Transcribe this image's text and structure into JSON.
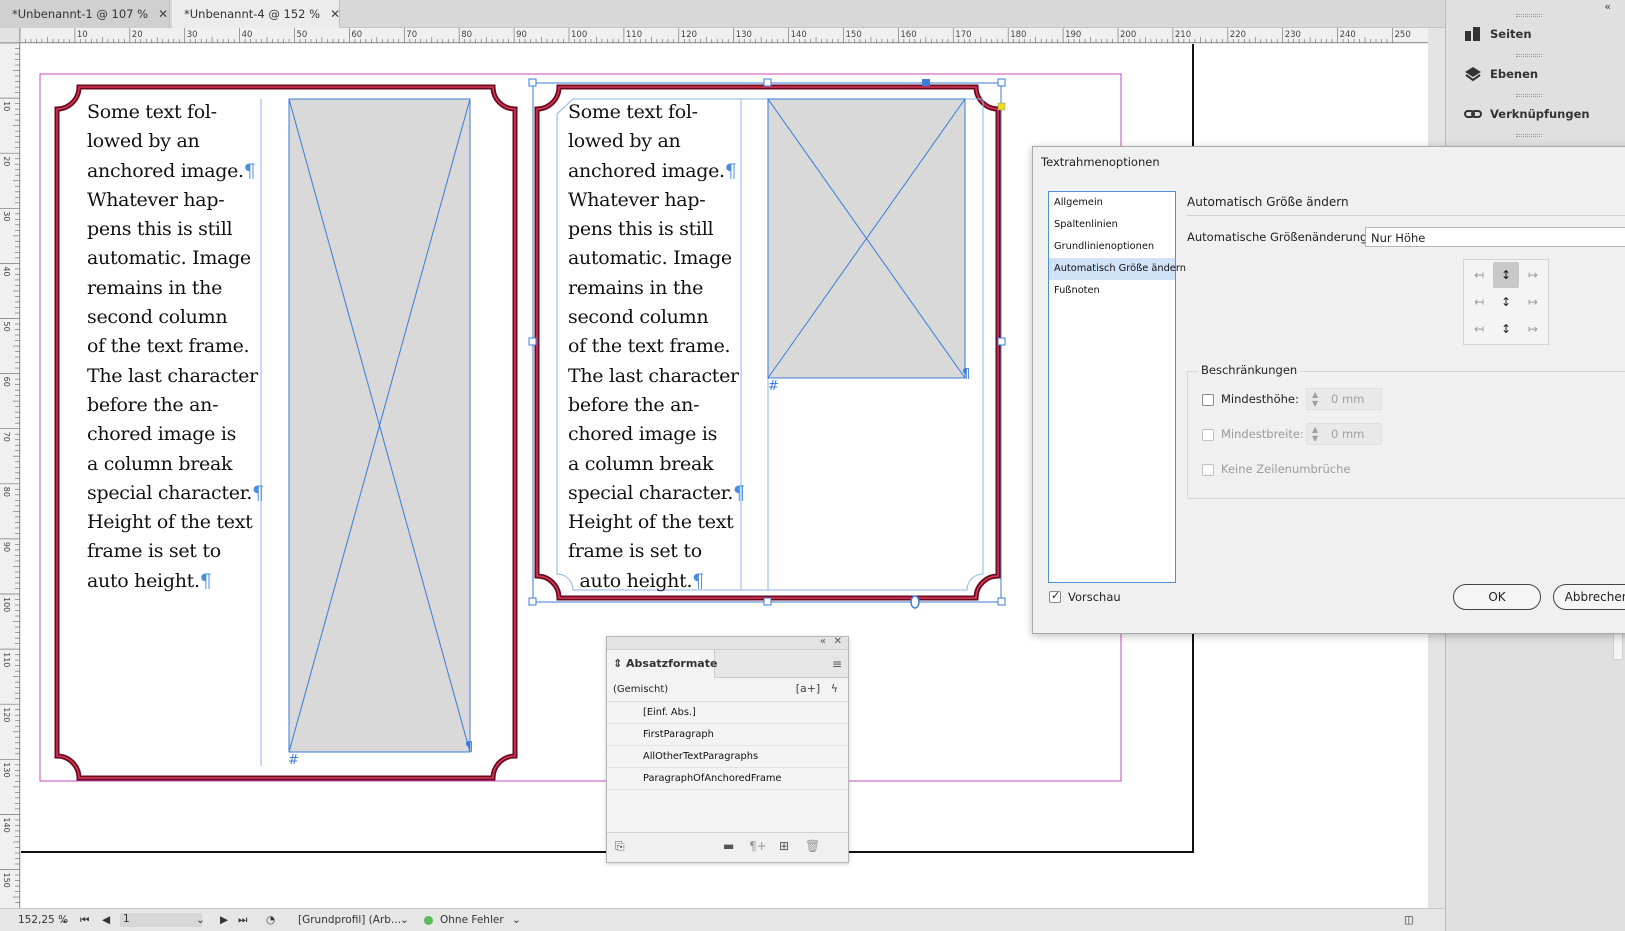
{
  "tabs": [
    {
      "label": "*Unbenannt-1 @ 107 %",
      "close": "✕"
    },
    {
      "label": "*Unbenannt-4 @ 152 %",
      "close": "✕"
    }
  ],
  "ruler": {
    "h_ticks": [
      "10",
      "20",
      "30",
      "40",
      "50",
      "60",
      "70",
      "80",
      "90",
      "100",
      "110",
      "120",
      "130",
      "140",
      "150",
      "160",
      "170",
      "180",
      "190",
      "200",
      "210",
      "220",
      "230",
      "240",
      "250"
    ],
    "v_ticks": [
      "10",
      "20",
      "30",
      "40",
      "50",
      "60",
      "70",
      "80",
      "90",
      "100",
      "110",
      "120",
      "130",
      "140",
      "150"
    ]
  },
  "frames": {
    "left_text": [
      "Some text fol-",
      "lowed by an",
      "anchored image.",
      "Whatever hap-",
      "pens this is still",
      "automatic. Image",
      "remains in the",
      "second column",
      "of the text frame.",
      "The last character",
      "before the an-",
      "chored image is",
      "a column break",
      "special character.",
      "Height of the text",
      "frame is set to",
      "auto height."
    ],
    "right_text": [
      "Some text fol-",
      "lowed by an",
      "anchored image.",
      "Whatever hap-",
      "pens this is still",
      "automatic. Image",
      "remains in the",
      "second column",
      "of the text frame.",
      "The last character",
      "before the an-",
      "chored image is",
      "a column break",
      "special character.",
      "Height of the text",
      "frame is set to",
      "  auto height."
    ],
    "pilcrow": "¶",
    "column_break": "#"
  },
  "dock": {
    "items": [
      {
        "label": "Seiten",
        "icon": "pages-icon"
      },
      {
        "label": "Ebenen",
        "icon": "layers-icon"
      },
      {
        "label": "Verknüpfungen",
        "icon": "links-icon"
      }
    ],
    "collapse": "«"
  },
  "dialog": {
    "title": "Textrahmenoptionen",
    "nav": [
      "Allgemein",
      "Spaltenlinien",
      "Grundlinienoptionen",
      "Automatisch Größe ändern",
      "Fußnoten"
    ],
    "selected_nav": "Automatisch Größe ändern",
    "section_title": "Automatisch Größe ändern",
    "autosize_label": "Automatische Größenänderung",
    "autosize_value": "Nur Höhe",
    "constraints_title": "Beschränkungen",
    "min_height_label": "Mindesthöhe:",
    "min_height_value": "0 mm",
    "min_width_label": "Mindestbreite:",
    "min_width_value": "0 mm",
    "no_line_breaks_label": "Keine Zeilenumbrüche",
    "preview_label": "Vorschau",
    "ok_label": "OK",
    "cancel_label": "Abbrechen"
  },
  "paragraph_styles_panel": {
    "title": "Absatzformate",
    "current": "(Gemischt)",
    "styles": [
      "[Einf. Abs.]",
      "FirstParagraph",
      "AllOtherTextParagraphs",
      "ParagraphOfAnchoredFrame"
    ],
    "collapse": "«",
    "close": "✕",
    "menu": "≡",
    "new_style_icon": "[a+]",
    "quick_apply_icon": "ϟ"
  },
  "statusbar": {
    "zoom": "152,25 %",
    "page": "1",
    "profile": "[Grundprofil] (Arb...",
    "preflight": "Ohne Fehler",
    "preflight_color": "#5cb85c"
  },
  "colors": {
    "frame_stroke": "#b0203c",
    "frame_outline": "#6a0a1f",
    "selection": "#3b7bd9",
    "margin_guide": "#c64bc6",
    "image_fill": "#d9d9d9"
  }
}
